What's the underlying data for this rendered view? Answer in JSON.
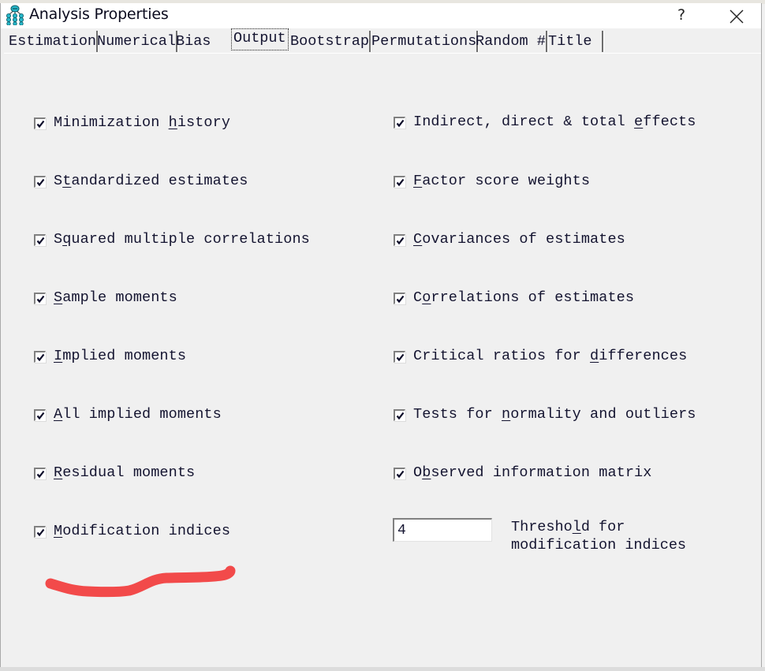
{
  "window": {
    "title": "Analysis Properties",
    "app_icon": "path-diagram-icon",
    "help_label": "?",
    "close_icon": "close-icon"
  },
  "tabs": [
    {
      "label": "Estimation",
      "active": false
    },
    {
      "label": "Numerical",
      "active": false
    },
    {
      "label": "Bias",
      "active": false
    },
    {
      "label": "Output",
      "active": true
    },
    {
      "label": "Bootstrap",
      "active": false
    },
    {
      "label": "Permutations",
      "active": false
    },
    {
      "label": "Random #",
      "active": false
    },
    {
      "label": "Title",
      "active": false
    }
  ],
  "options_left": [
    {
      "pre": "Minimization ",
      "accel": "h",
      "post": "istory",
      "checked": true
    },
    {
      "pre": "S",
      "accel": "t",
      "post": "andardized estimates",
      "checked": true
    },
    {
      "pre": "S",
      "accel": "q",
      "post": "uared multiple correlations",
      "checked": true
    },
    {
      "pre": "",
      "accel": "S",
      "post": "ample moments",
      "checked": true
    },
    {
      "pre": "",
      "accel": "I",
      "post": "mplied moments",
      "checked": true
    },
    {
      "pre": "",
      "accel": "A",
      "post": "ll implied moments",
      "checked": true
    },
    {
      "pre": "",
      "accel": "R",
      "post": "esidual moments",
      "checked": true
    },
    {
      "pre": "",
      "accel": "M",
      "post": "odification indices",
      "checked": true
    }
  ],
  "options_right": [
    {
      "pre": "Indirect, direct & total ",
      "accel": "e",
      "post": "ffects",
      "checked": true
    },
    {
      "pre": "",
      "accel": "F",
      "post": "actor score weights",
      "checked": true
    },
    {
      "pre": "",
      "accel": "C",
      "post": "ovariances of estimates",
      "checked": true
    },
    {
      "pre": "C",
      "accel": "o",
      "post": "rrelations of estimates",
      "checked": true
    },
    {
      "pre": "Critical ratios for ",
      "accel": "d",
      "post": "ifferences",
      "checked": true
    },
    {
      "pre": "Tests for ",
      "accel": "n",
      "post": "ormality and outliers",
      "checked": true
    },
    {
      "pre": "O",
      "accel": "b",
      "post": "served information matrix",
      "checked": true
    }
  ],
  "threshold": {
    "value": "4",
    "label_line1_pre": "Thresho",
    "label_line1_accel": "l",
    "label_line1_post": "d for",
    "label_line2": "modification indices"
  },
  "annotation": {
    "type": "hand-drawn-underline",
    "color": "#f24a4a",
    "marks": "Modification indices"
  }
}
